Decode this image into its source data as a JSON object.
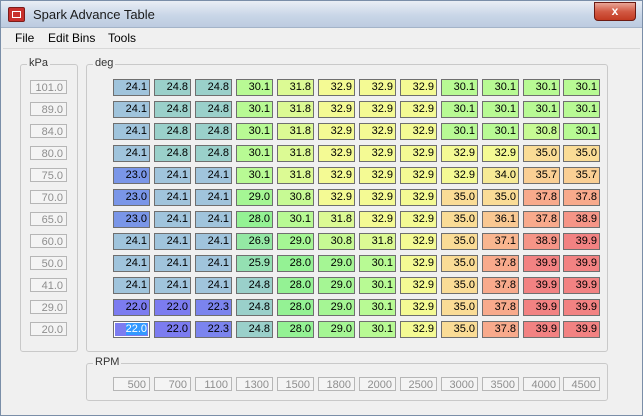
{
  "window": {
    "title": "Spark Advance Table",
    "close_label": "x"
  },
  "menu": [
    "File",
    "Edit Bins",
    "Tools"
  ],
  "kpa": {
    "label": "kPa",
    "values": [
      "101.0",
      "89.0",
      "84.0",
      "80.0",
      "75.0",
      "70.0",
      "65.0",
      "60.0",
      "50.0",
      "41.0",
      "29.0",
      "20.0"
    ]
  },
  "deg": {
    "label": "deg"
  },
  "rpm": {
    "label": "RPM",
    "values": [
      "500",
      "700",
      "1100",
      "1300",
      "1500",
      "1800",
      "2000",
      "2500",
      "3000",
      "3500",
      "4000",
      "4500"
    ]
  },
  "table": [
    [
      "24.1",
      "24.8",
      "24.8",
      "30.1",
      "31.8",
      "32.9",
      "32.9",
      "32.9",
      "30.1",
      "30.1",
      "30.1",
      "30.1"
    ],
    [
      "24.1",
      "24.8",
      "24.8",
      "30.1",
      "31.8",
      "32.9",
      "32.9",
      "32.9",
      "30.1",
      "30.1",
      "30.1",
      "30.1"
    ],
    [
      "24.1",
      "24.8",
      "24.8",
      "30.1",
      "31.8",
      "32.9",
      "32.9",
      "32.9",
      "30.1",
      "30.1",
      "30.8",
      "30.1"
    ],
    [
      "24.1",
      "24.8",
      "24.8",
      "30.1",
      "31.8",
      "32.9",
      "32.9",
      "32.9",
      "32.9",
      "32.9",
      "35.0",
      "35.0"
    ],
    [
      "23.0",
      "24.1",
      "24.1",
      "30.1",
      "31.8",
      "32.9",
      "32.9",
      "32.9",
      "32.9",
      "34.0",
      "35.7",
      "35.7"
    ],
    [
      "23.0",
      "24.1",
      "24.1",
      "29.0",
      "30.8",
      "32.9",
      "32.9",
      "32.9",
      "35.0",
      "35.0",
      "37.8",
      "37.8"
    ],
    [
      "23.0",
      "24.1",
      "24.1",
      "28.0",
      "30.1",
      "31.8",
      "32.9",
      "32.9",
      "35.0",
      "36.1",
      "37.8",
      "38.9"
    ],
    [
      "24.1",
      "24.1",
      "24.1",
      "26.9",
      "29.0",
      "30.8",
      "31.8",
      "32.9",
      "35.0",
      "37.1",
      "38.9",
      "39.9"
    ],
    [
      "24.1",
      "24.1",
      "24.1",
      "25.9",
      "28.0",
      "29.0",
      "30.1",
      "32.9",
      "35.0",
      "37.8",
      "39.9",
      "39.9"
    ],
    [
      "24.1",
      "24.1",
      "24.1",
      "24.8",
      "28.0",
      "29.0",
      "30.1",
      "32.9",
      "35.0",
      "37.8",
      "39.9",
      "39.9"
    ],
    [
      "22.0",
      "22.0",
      "22.3",
      "24.8",
      "28.0",
      "29.0",
      "30.1",
      "32.9",
      "35.0",
      "37.8",
      "39.9",
      "39.9"
    ],
    [
      "22.0",
      "22.0",
      "22.3",
      "24.8",
      "28.0",
      "29.0",
      "30.1",
      "32.9",
      "35.0",
      "37.8",
      "39.9",
      "39.9"
    ]
  ],
  "selected_cell": {
    "row": 11,
    "col": 0
  }
}
